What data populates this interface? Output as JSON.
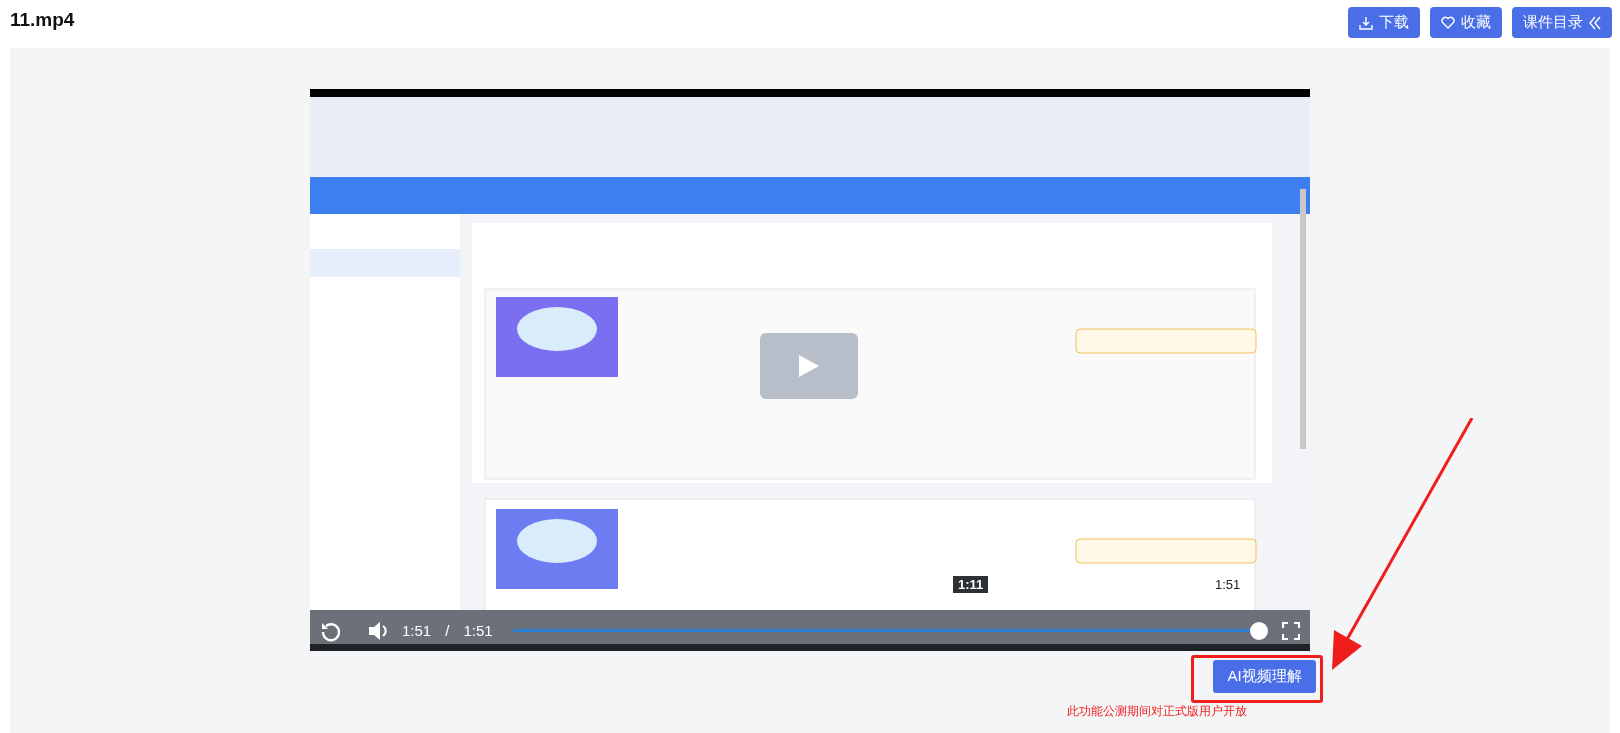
{
  "title": "11.mp4",
  "actions": [
    {
      "kind": "download",
      "label": "下载"
    },
    {
      "kind": "favorite",
      "label": "收藏"
    },
    {
      "kind": "catalog",
      "label": "课件目录"
    }
  ],
  "player": {
    "kind": "picture",
    "paused": true,
    "current_time": "1:51",
    "separator": "/",
    "duration": "1:51",
    "level": 1,
    "hover_time": "1:11",
    "thumb_time": "1:51"
  },
  "ai_button": "AI视频理解",
  "notice": "此功能公测期间对正式版用户开放"
}
